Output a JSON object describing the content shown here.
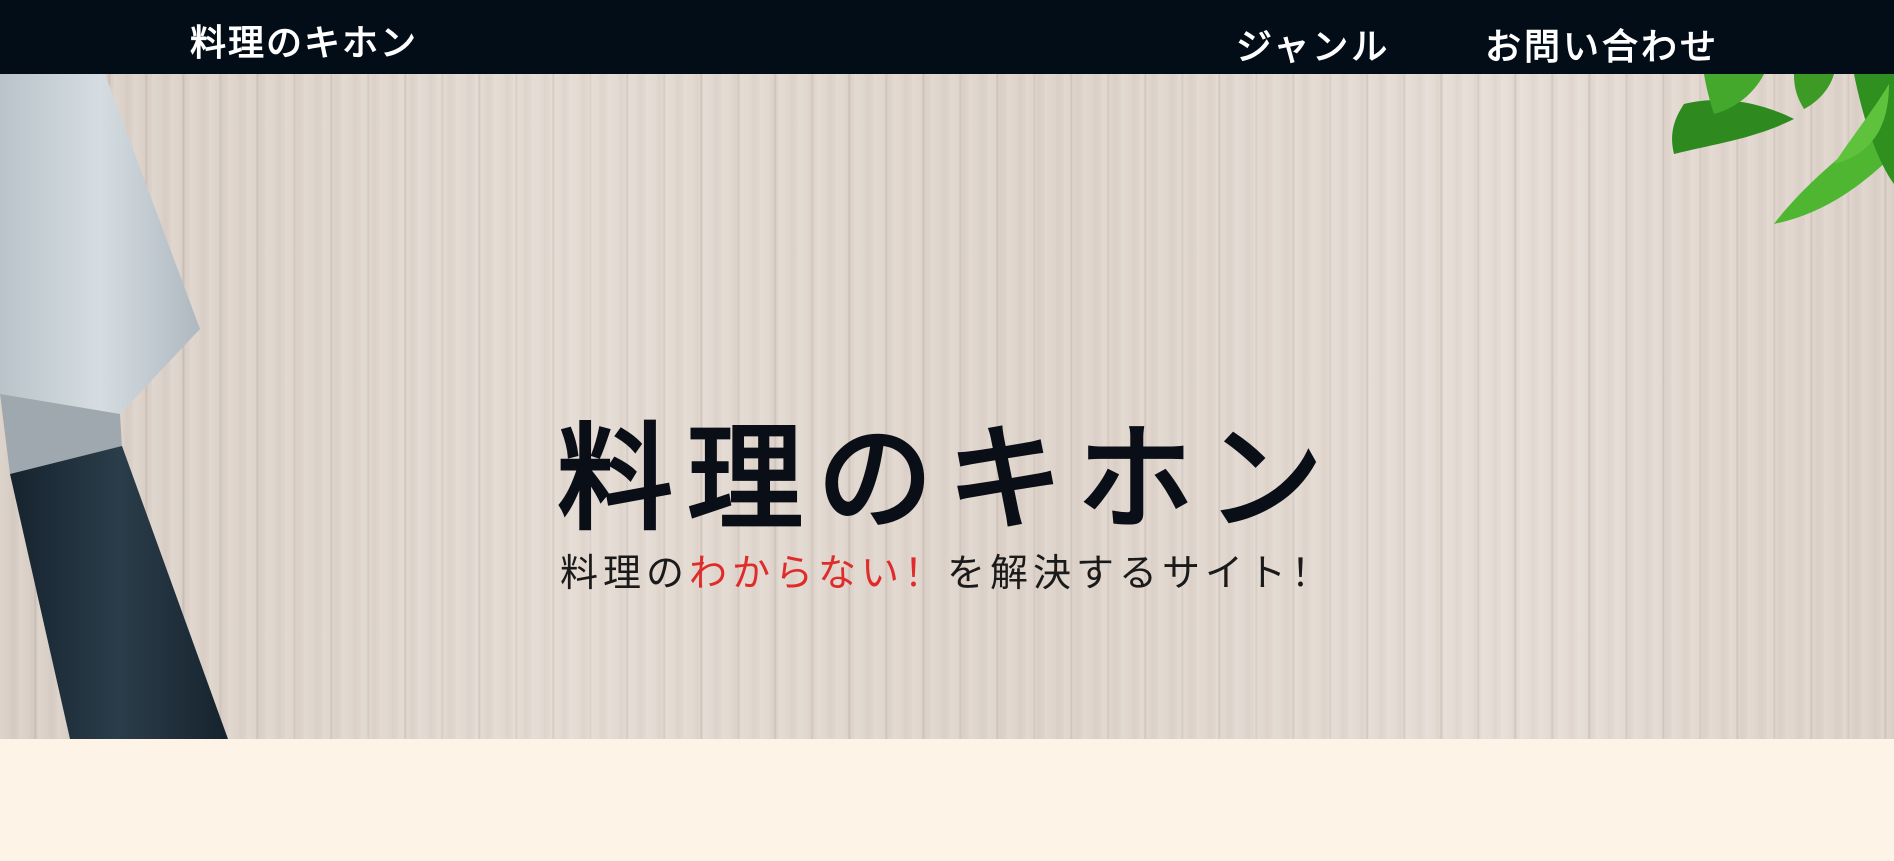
{
  "header": {
    "logo": "料理のキホン",
    "nav": [
      {
        "label": "ジャンル"
      },
      {
        "label": "お問い合わせ"
      }
    ]
  },
  "hero": {
    "title": "料理のキホン",
    "tagline": {
      "prefix": "料理の",
      "highlight": "わからない！",
      "suffix": "を解決するサイト！"
    }
  },
  "colors": {
    "header_bg": "#020d18",
    "header_text": "#ffffff",
    "title": "#0a0f17",
    "highlight": "#e02b2b",
    "page_bg": "#fdf3e7"
  }
}
